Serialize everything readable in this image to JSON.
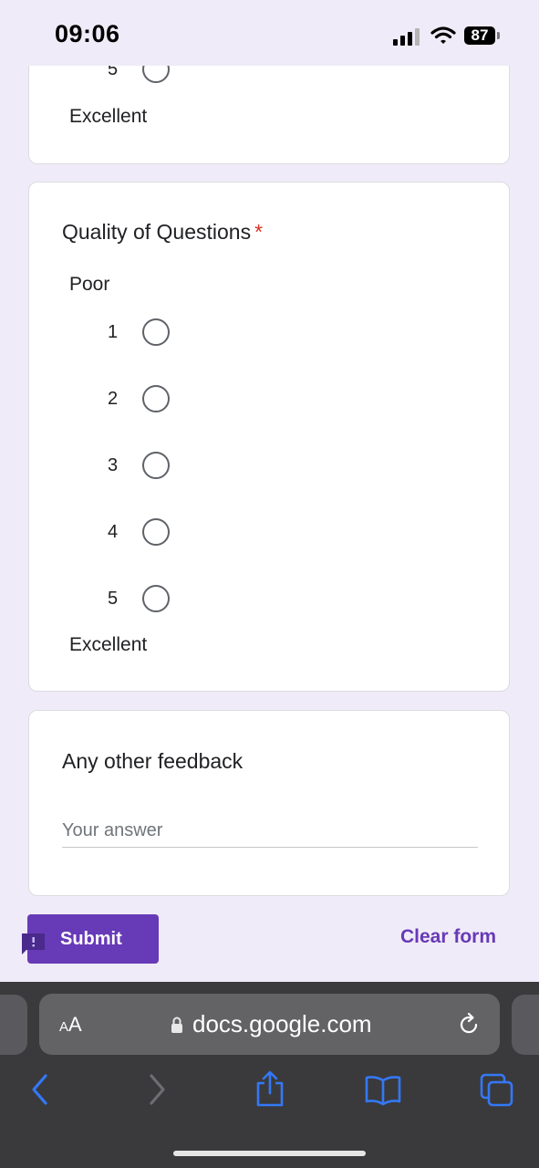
{
  "status": {
    "time": "09:06",
    "battery": "87"
  },
  "form": {
    "prev_question": {
      "last_option": "5",
      "high_label": "Excellent"
    },
    "question": {
      "title": "Quality of Questions",
      "required_mark": "*",
      "low_label": "Poor",
      "high_label": "Excellent",
      "options": [
        "1",
        "2",
        "3",
        "4",
        "5"
      ]
    },
    "feedback": {
      "title": "Any other feedback",
      "placeholder": "Your answer",
      "value": ""
    },
    "submit_label": "Submit",
    "clear_label": "Clear form"
  },
  "browser": {
    "text_size_label_large": "A",
    "text_size_label_small": "A",
    "url": "docs.google.com"
  },
  "icons": [
    "signal-icon",
    "wifi-icon",
    "battery-icon",
    "feedback-icon",
    "lock-icon",
    "reload-icon",
    "back-icon",
    "forward-icon",
    "share-icon",
    "bookmarks-icon",
    "tabs-icon"
  ],
  "colors": {
    "background": "#f0ebf8",
    "accent": "#673ab7",
    "required": "#d93025",
    "toolbar": "#3a3a3c",
    "toolbar_icon": "#3478f6"
  }
}
